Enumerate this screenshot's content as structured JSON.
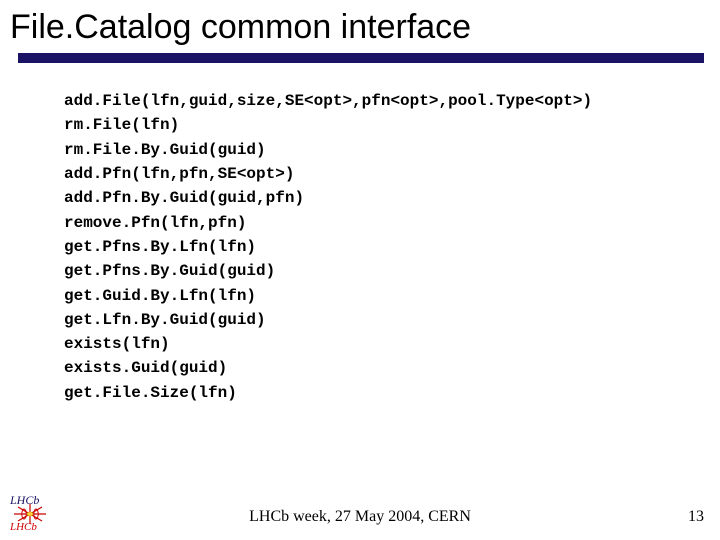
{
  "title": "File.Catalog common interface",
  "api": [
    "add.File(lfn,guid,size,SE<opt>,pfn<opt>,pool.Type<opt>)",
    "rm.File(lfn)",
    "rm.File.By.Guid(guid)",
    "add.Pfn(lfn,pfn,SE<opt>)",
    "add.Pfn.By.Guid(guid,pfn)",
    "remove.Pfn(lfn,pfn)",
    "get.Pfns.By.Lfn(lfn)",
    "get.Pfns.By.Guid(guid)",
    "get.Guid.By.Lfn(lfn)",
    "get.Lfn.By.Guid(guid)",
    "exists(lfn)",
    "exists.Guid(guid)",
    "get.File.Size(lfn)"
  ],
  "footer": {
    "center": "LHCb week, 27 May 2004, CERN",
    "page": "13"
  },
  "logo_text_top": "LHCb",
  "logo_text_bottom": "LHCb"
}
